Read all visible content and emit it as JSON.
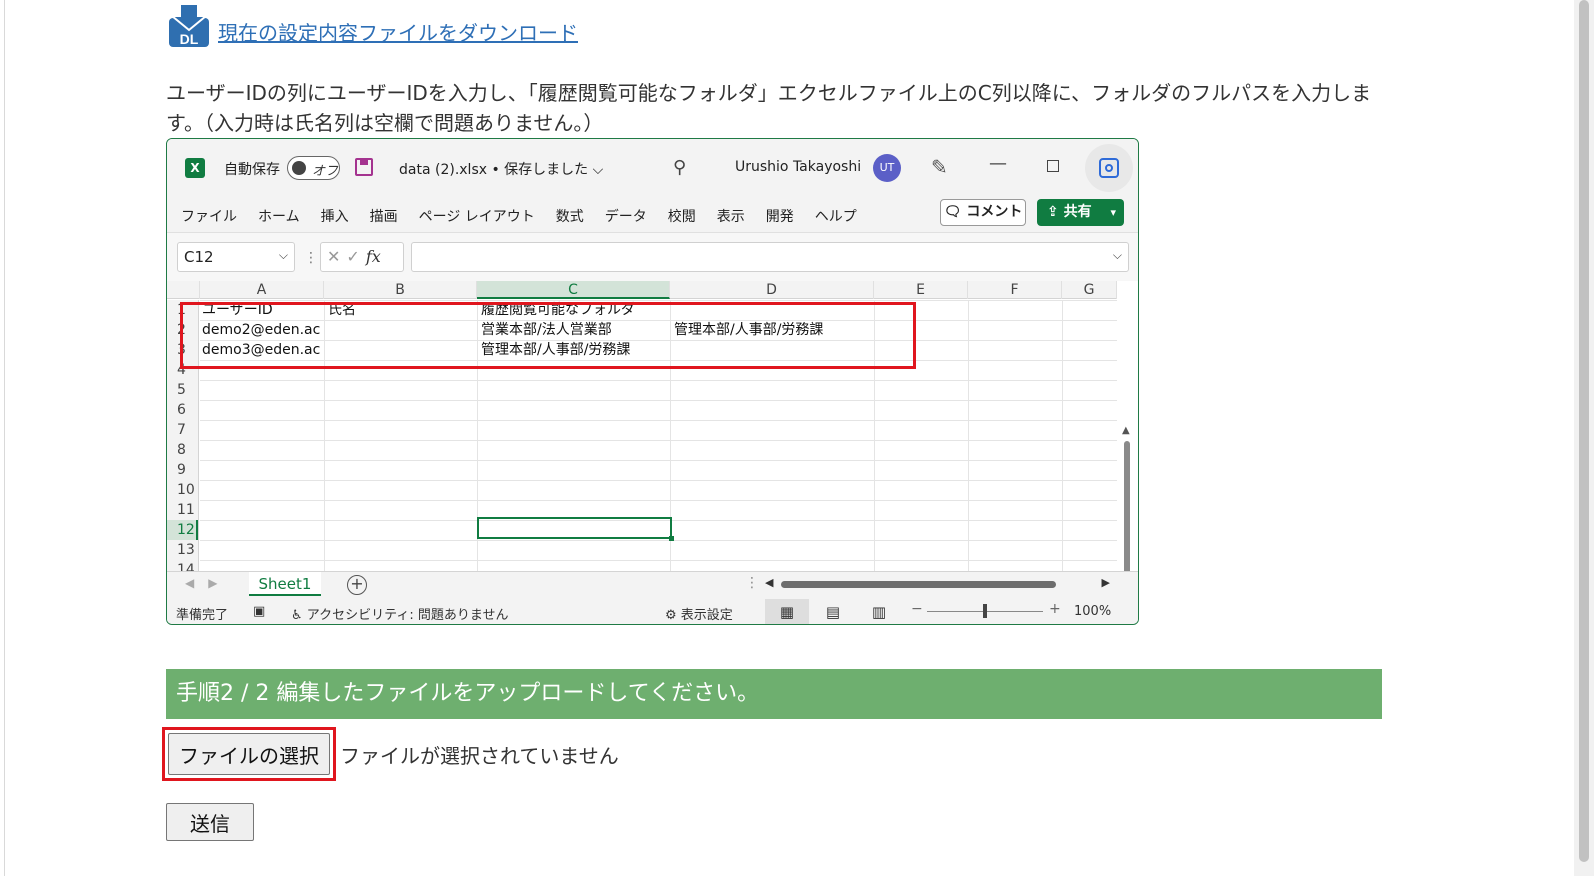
{
  "download": {
    "link_text": "現在の設定内容ファイルをダウンロード",
    "icon_label": "DL",
    "icon": "download-icon"
  },
  "instructions": "ユーザーIDの列にユーザーIDを入力し、「履歴閲覧可能なフォルダ」エクセルファイル上のC列以降に、フォルダのフルパスを入力します。（入力時は氏名列は空欄で問題ありません。）",
  "excel": {
    "titlebar": {
      "app_icon_label": "X",
      "autosave_label": "自動保存",
      "toggle_label": "オフ",
      "filename": "data (2).xlsx • 保存しました",
      "user_name": "Urushio Takayoshi",
      "avatar_initials": "UT"
    },
    "menu": [
      "ファイル",
      "ホーム",
      "挿入",
      "描画",
      "ページ レイアウト",
      "数式",
      "データ",
      "校閲",
      "表示",
      "開発",
      "ヘルプ"
    ],
    "comment_label": "コメント",
    "share_label": "共有",
    "name_box": "C12",
    "fx_label": "fx",
    "columns": [
      "A",
      "B",
      "C",
      "D",
      "E",
      "F",
      "G"
    ],
    "selected_column": "C",
    "rows": [
      "1",
      "2",
      "3",
      "4",
      "5",
      "6",
      "7",
      "8",
      "9",
      "10",
      "11",
      "12",
      "13",
      "14"
    ],
    "selected_row": "12",
    "cells": {
      "A1": "ユーザーID",
      "B1": "氏名",
      "C1": "履歴閲覧可能なフォルダ",
      "A2": "demo2@eden.ac",
      "C2": "営業本部/法人営業部",
      "D2": "管理本部/人事部/労務課",
      "A3": "demo3@eden.ac",
      "C3": "管理本部/人事部/労務課"
    },
    "sheet_tab": "Sheet1",
    "status": {
      "ready": "準備完了",
      "accessibility": "アクセシビリティ: 問題ありません",
      "display_settings": "表示設定",
      "zoom": "100%"
    }
  },
  "step_banner": "手順2 / 2 編集したファイルをアップロードしてください。",
  "file_input": {
    "button_label": "ファイルの選択",
    "status": "ファイルが選択されていません"
  },
  "submit_label": "送信",
  "colors": {
    "link": "#2e6fb6",
    "banner": "#6eaf6f",
    "highlight": "#e0161e",
    "excel_green": "#107c41"
  }
}
